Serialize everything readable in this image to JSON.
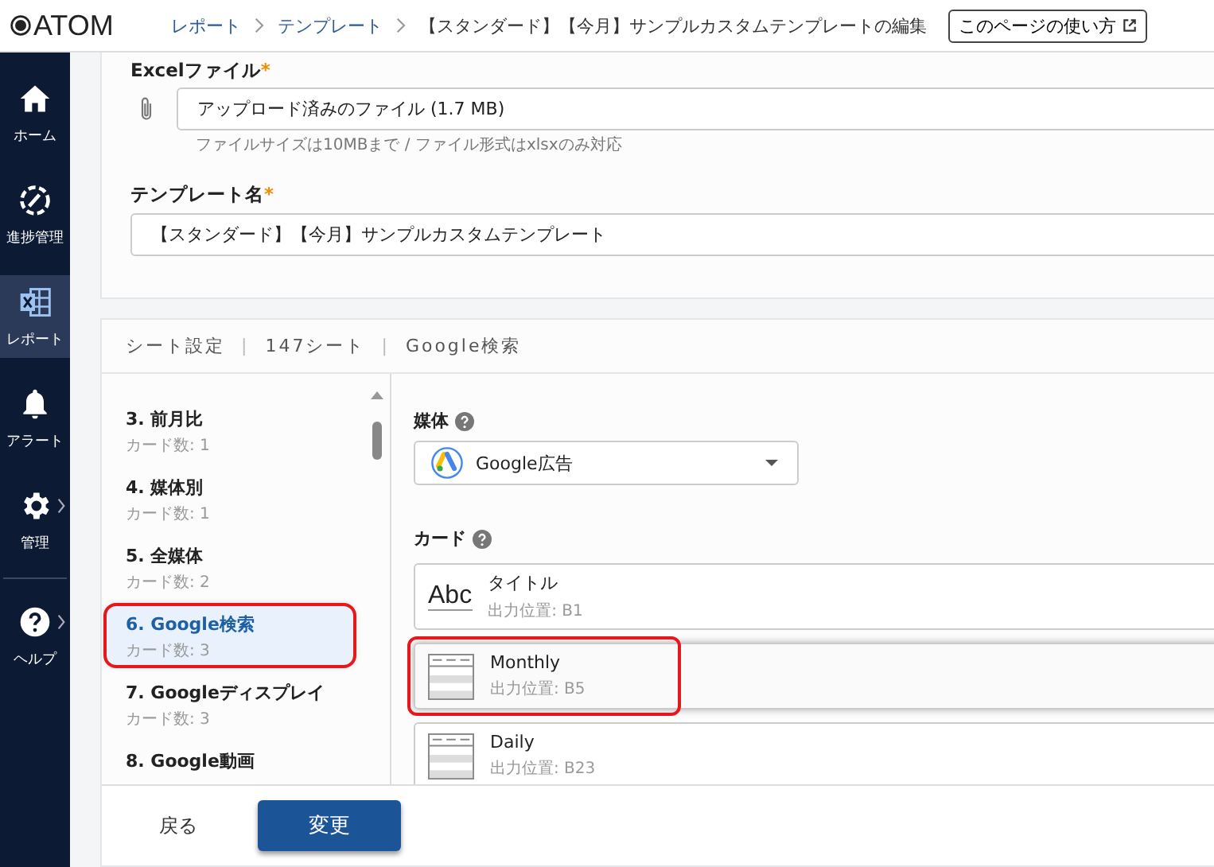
{
  "header": {
    "logo": "ATOM",
    "breadcrumbs": [
      {
        "label": "レポート",
        "link": true
      },
      {
        "label": "テンプレート",
        "link": true
      },
      {
        "label": "【スタンダード】【今月】サンプルカスタムテンプレートの編集",
        "link": false
      }
    ],
    "help_button": "このページの使い方"
  },
  "sidebar": {
    "items": [
      {
        "label": "ホーム",
        "selected": false,
        "submenu": false
      },
      {
        "label": "進捗管理",
        "selected": false,
        "submenu": false
      },
      {
        "label": "レポート",
        "selected": true,
        "submenu": false
      },
      {
        "label": "アラート",
        "selected": false,
        "submenu": false
      },
      {
        "label": "管理",
        "selected": false,
        "submenu": true
      },
      {
        "label": "ヘルプ",
        "selected": false,
        "submenu": true
      }
    ]
  },
  "excel_file": {
    "label": "Excelファイル",
    "required_mark": "*",
    "value": "アップロード済みのファイル (1.7 MB)",
    "hint": "ファイルサイズは10MBまで / ファイル形式はxlsxのみ対応"
  },
  "template_name": {
    "label": "テンプレート名",
    "required_mark": "*",
    "value": "【スタンダード】【今月】サンプルカスタムテンプレート"
  },
  "sheet_settings": {
    "tabs": [
      "シート設定",
      "147シート",
      "Google検索"
    ],
    "separator": "|",
    "sheets": [
      {
        "name": "3. 前月比",
        "count": "カード数: 1",
        "selected": false,
        "highlighted": false
      },
      {
        "name": "4. 媒体別",
        "count": "カード数: 1",
        "selected": false,
        "highlighted": false
      },
      {
        "name": "5. 全媒体",
        "count": "カード数: 2",
        "selected": false,
        "highlighted": false
      },
      {
        "name": "6. Google検索",
        "count": "カード数: 3",
        "selected": true,
        "highlighted": true
      },
      {
        "name": "7. Googleディスプレイ",
        "count": "カード数: 3",
        "selected": false,
        "highlighted": false
      },
      {
        "name": "8. Google動画",
        "selected": false,
        "highlighted": false
      }
    ],
    "media_label": "媒体",
    "media_value": "Google広告",
    "cards_label": "カード",
    "cards": [
      {
        "kind": "text",
        "icon_text": "Abc",
        "name": "タイトル",
        "position": "出力位置: B1",
        "highlighted": false
      },
      {
        "kind": "table",
        "name": "Monthly",
        "position": "出力位置: B5",
        "highlighted": true
      },
      {
        "kind": "table",
        "name": "Daily",
        "position": "出力位置: B23",
        "highlighted": false
      }
    ]
  },
  "footer": {
    "back": "戻る",
    "submit": "変更"
  }
}
